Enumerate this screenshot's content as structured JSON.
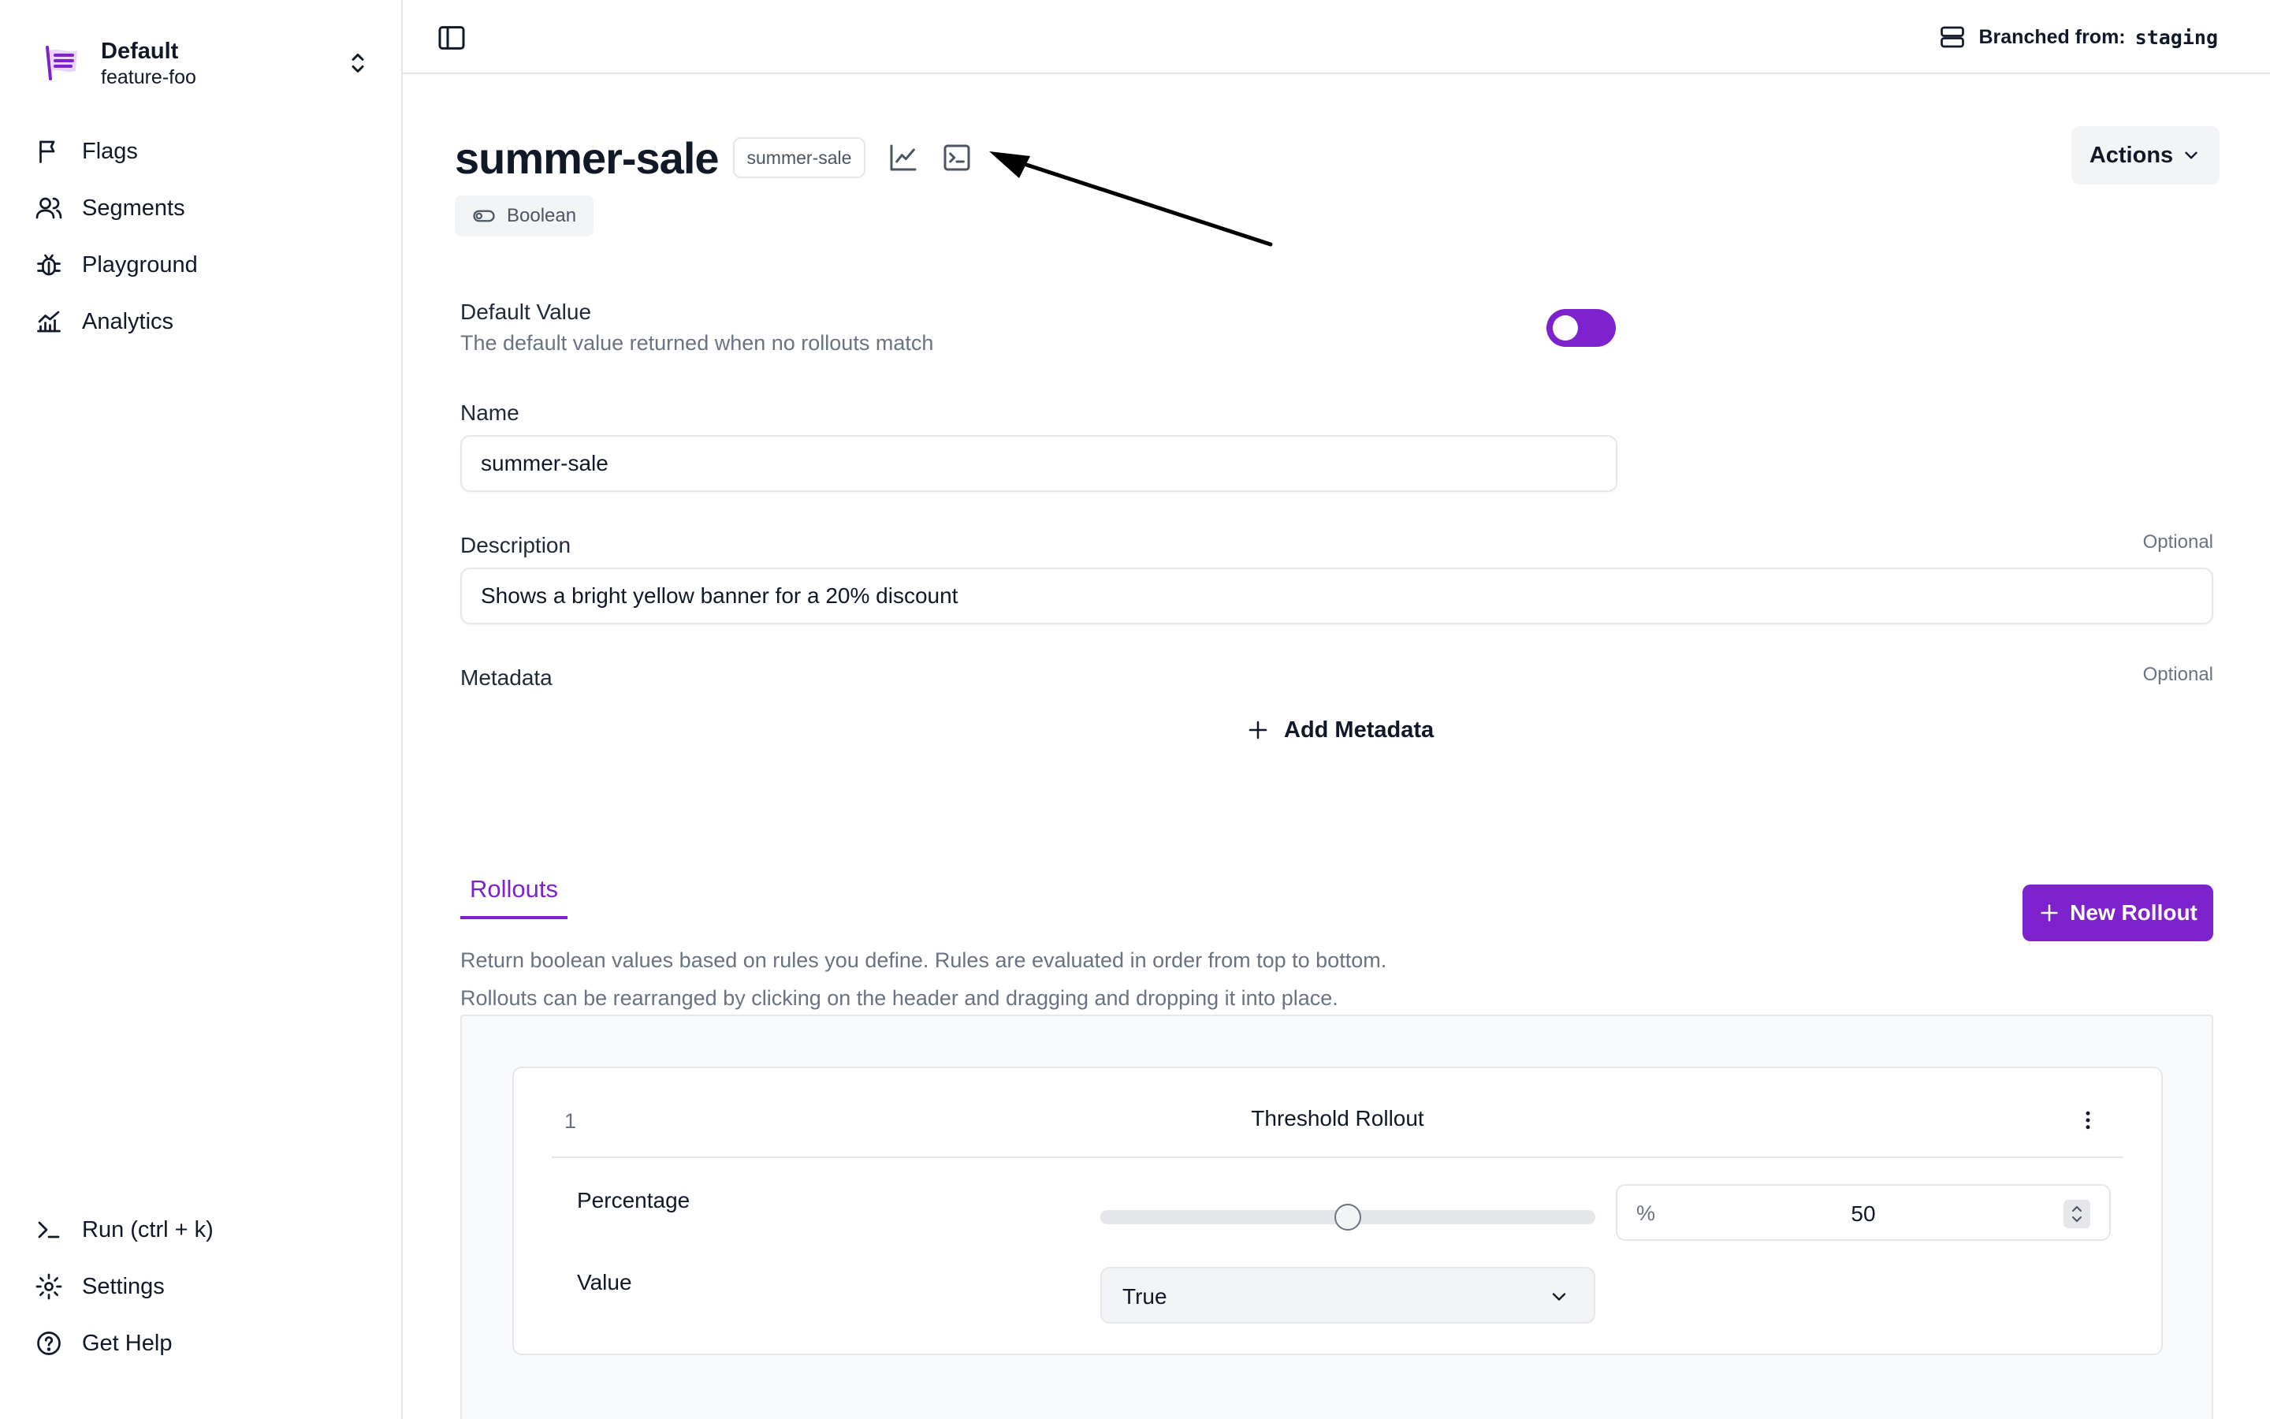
{
  "sidebar": {
    "namespace": {
      "title": "Default",
      "subtitle": "feature-foo"
    },
    "items": [
      {
        "label": "Flags",
        "icon": "flag-icon"
      },
      {
        "label": "Segments",
        "icon": "users-icon"
      },
      {
        "label": "Playground",
        "icon": "bug-icon"
      },
      {
        "label": "Analytics",
        "icon": "chart-icon"
      }
    ],
    "bottom_items": [
      {
        "label": "Run (ctrl + k)",
        "icon": "terminal-prompt-icon"
      },
      {
        "label": "Settings",
        "icon": "gear-icon"
      },
      {
        "label": "Get Help",
        "icon": "help-icon"
      }
    ]
  },
  "topbar": {
    "branch_label": "Branched from:",
    "branch_value": "staging"
  },
  "flag": {
    "title": "summer-sale",
    "key": "summer-sale",
    "type": "Boolean",
    "actions_label": "Actions"
  },
  "form": {
    "default_value": {
      "label": "Default Value",
      "description": "The default value returned when no rollouts match",
      "enabled": false
    },
    "name": {
      "label": "Name",
      "value": "summer-sale"
    },
    "description": {
      "label": "Description",
      "optional": "Optional",
      "value": "Shows a bright yellow banner for a 20% discount"
    },
    "metadata": {
      "label": "Metadata",
      "optional": "Optional",
      "add_label": "Add Metadata"
    }
  },
  "rollouts": {
    "tab_label": "Rollouts",
    "description_line1": "Return boolean values based on rules you define. Rules are evaluated in order from top to bottom.",
    "description_line2": "Rollouts can be rearranged by clicking on the header and dragging and dropping it into place.",
    "new_button": "New Rollout",
    "items": [
      {
        "index": "1",
        "title": "Threshold Rollout",
        "percentage_label": "Percentage",
        "percentage_unit": "%",
        "percentage_value": "50",
        "value_label": "Value",
        "value": "True"
      }
    ]
  },
  "colors": {
    "accent": "#7e22ce",
    "text": "#111827",
    "muted": "#6b7280",
    "border": "#e5e7eb"
  }
}
